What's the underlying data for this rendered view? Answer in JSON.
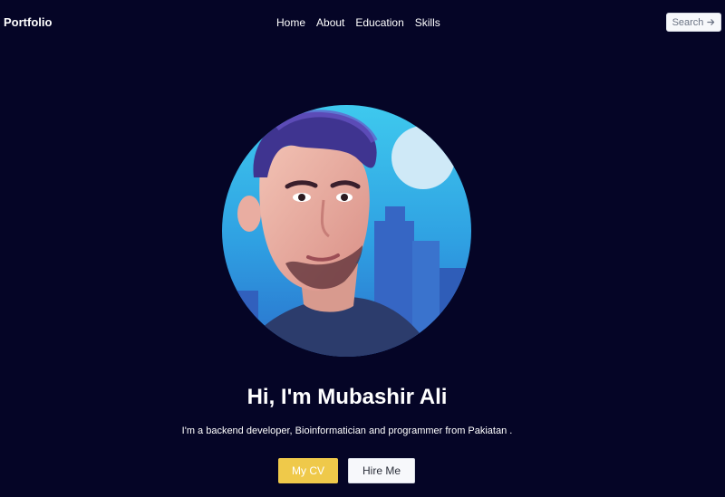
{
  "nav": {
    "brand": "Portfolio",
    "links": [
      "Home",
      "About",
      "Education",
      "Skills"
    ],
    "search_label": "Search",
    "search_icon": "arrow-right-icon"
  },
  "hero": {
    "avatar_alt": "profile-illustration",
    "headline": "Hi, I'm Mubashir Ali",
    "tagline": "I'm a backend developer, Bioinformatician and programmer from Pakiatan .",
    "cv_label": "My CV",
    "hire_label": "Hire Me"
  },
  "colors": {
    "background": "#050526",
    "accent": "#efc94a",
    "avatar_sky": "#3fb8e8"
  }
}
